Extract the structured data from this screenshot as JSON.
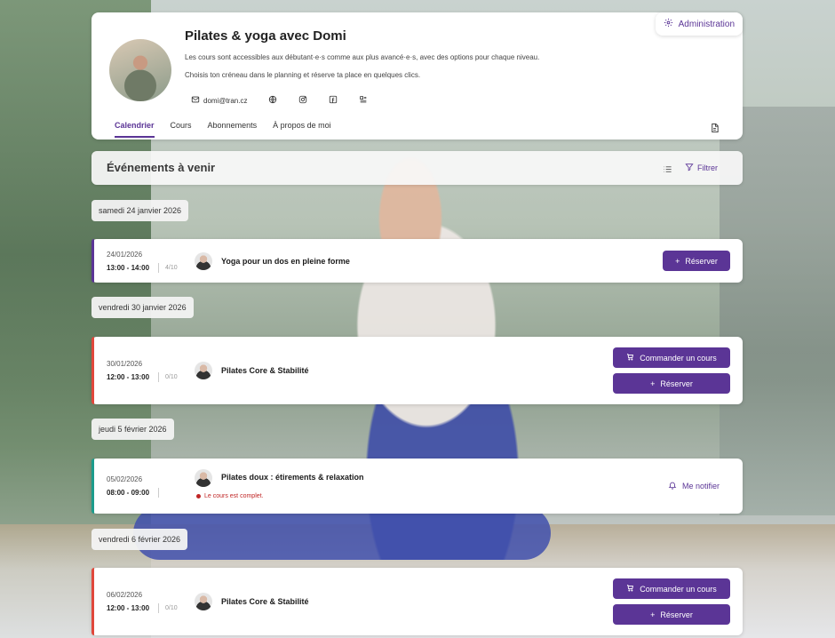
{
  "profile": {
    "title": "Pilates & yoga avec Domi",
    "description_1": "Les cours sont accessibles aux débutant·e·s comme aux plus avancé·e·s, avec des options pour chaque niveau.",
    "description_2": "Choisis ton créneau dans le planning et réserve ta place en quelques clics.",
    "email": "domi@tran.cz",
    "admin_label": "Administration"
  },
  "tabs": [
    {
      "label": "Calendrier",
      "active": true
    },
    {
      "label": "Cours",
      "active": false
    },
    {
      "label": "Abonnements",
      "active": false
    },
    {
      "label": "À propos de moi",
      "active": false
    }
  ],
  "events_header": {
    "title": "Événements à venir",
    "filter_label": "Filtrer"
  },
  "days": [
    {
      "label": "samedi 24 janvier 2026"
    },
    {
      "label": "vendredi 30 janvier 2026"
    },
    {
      "label": "jeudi 5 février 2026"
    },
    {
      "label": "vendredi 6 février 2026"
    }
  ],
  "events": [
    {
      "date": "24/01/2026",
      "time": "13:00 - 14:00",
      "capacity": "4/10",
      "name": "Yoga pour un dos en pleine forme",
      "accent": "#5b3596",
      "reserve_label": "Réserver"
    },
    {
      "date": "30/01/2026",
      "time": "12:00 - 13:00",
      "capacity": "0/10",
      "name": "Pilates Core & Stabilité",
      "accent": "#e0473b",
      "order_label": "Commander un cours",
      "reserve_label": "Réserver"
    },
    {
      "date": "05/02/2026",
      "time": "08:00 - 09:00",
      "capacity": "",
      "name": "Pilates doux : étirements & relaxation",
      "accent": "#1b9c8c",
      "full_label": "Le cours est complet.",
      "notify_label": "Me notifier"
    },
    {
      "date": "06/02/2026",
      "time": "12:00 - 13:00",
      "capacity": "0/10",
      "name": "Pilates Core & Stabilité",
      "accent": "#e0473b",
      "order_label": "Commander un cours",
      "reserve_label": "Réserver"
    }
  ],
  "colors": {
    "brand": "#5b3596",
    "danger": "#c02626"
  }
}
